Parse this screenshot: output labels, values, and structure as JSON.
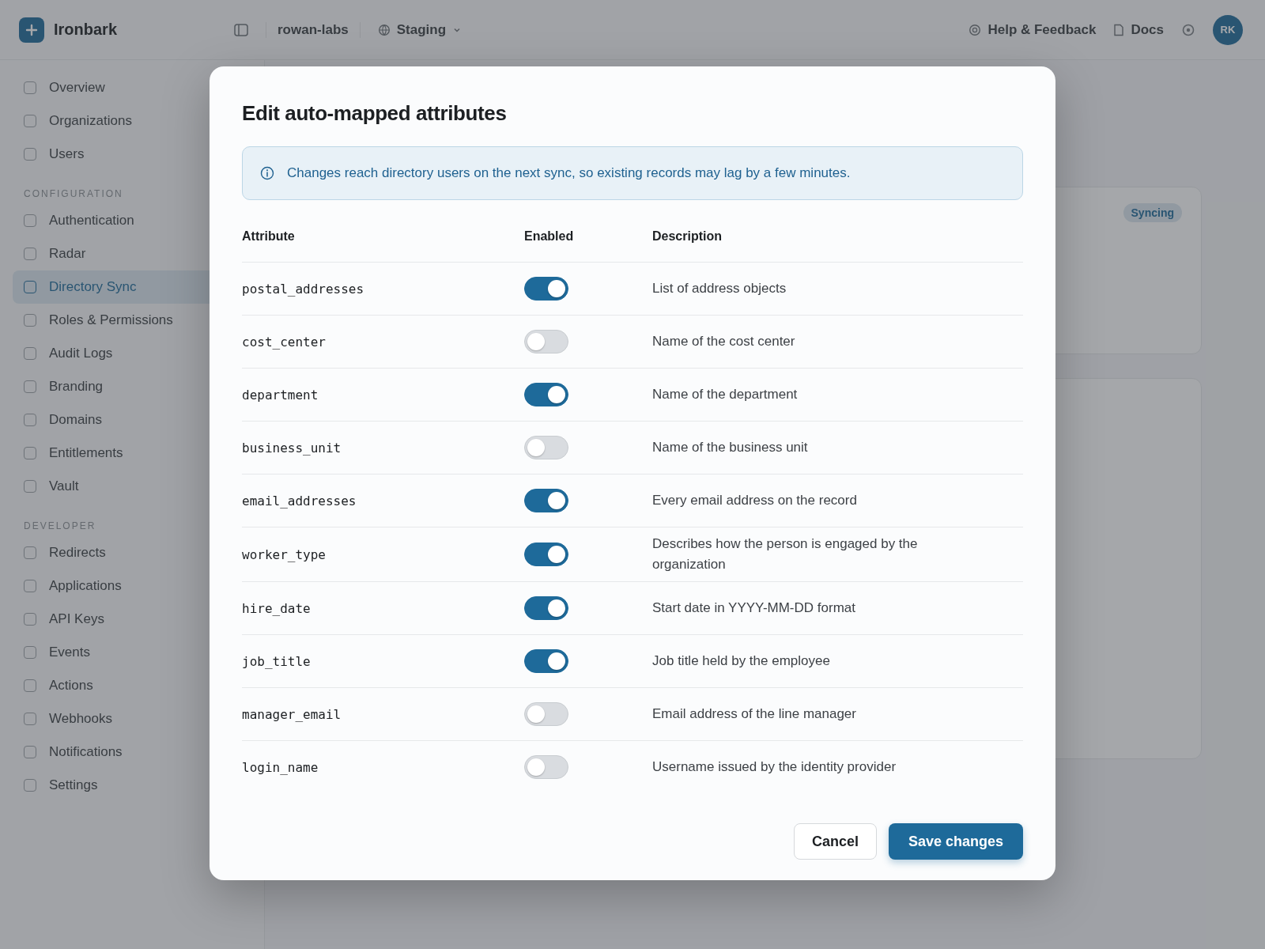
{
  "app": {
    "brand": "Ironbark",
    "org": "rowan-labs",
    "environment": "Staging",
    "help": "Help & Feedback",
    "docs": "Docs",
    "avatar": "RK"
  },
  "sidebar": {
    "sections": [
      {
        "items": [
          {
            "label": "Overview",
            "selected": false
          },
          {
            "label": "Organizations",
            "selected": false
          },
          {
            "label": "Users",
            "selected": false
          }
        ]
      },
      {
        "heading": "CONFIGURATION",
        "items": [
          {
            "label": "Authentication",
            "selected": false
          },
          {
            "label": "Radar",
            "selected": false
          },
          {
            "label": "Directory Sync",
            "selected": true
          },
          {
            "label": "Roles & Permissions",
            "selected": false
          },
          {
            "label": "Audit Logs",
            "selected": false
          },
          {
            "label": "Branding",
            "selected": false
          },
          {
            "label": "Domains",
            "selected": false
          },
          {
            "label": "Entitlements",
            "selected": false
          },
          {
            "label": "Vault",
            "selected": false
          }
        ]
      },
      {
        "heading": "DEVELOPER",
        "items": [
          {
            "label": "Redirects",
            "selected": false
          },
          {
            "label": "Applications",
            "selected": false
          },
          {
            "label": "API Keys",
            "selected": false
          },
          {
            "label": "Events",
            "selected": false
          },
          {
            "label": "Actions",
            "selected": false
          },
          {
            "label": "Webhooks",
            "selected": false
          },
          {
            "label": "Notifications",
            "selected": false
          },
          {
            "label": "Settings",
            "selected": false
          }
        ]
      }
    ]
  },
  "main": {
    "status_badge": "Syncing"
  },
  "dialog": {
    "title": "Edit auto-mapped attributes",
    "notice": "Changes reach directory users on the next sync, so existing records may lag by a few minutes.",
    "columns": [
      "Attribute",
      "Enabled",
      "Description"
    ],
    "rows": [
      {
        "attribute": "postal_addresses",
        "enabled": true,
        "description": "List of address objects"
      },
      {
        "attribute": "cost_center",
        "enabled": false,
        "description": "Name of the cost center"
      },
      {
        "attribute": "department",
        "enabled": true,
        "description": "Name of the department"
      },
      {
        "attribute": "business_unit",
        "enabled": false,
        "description": "Name of the business unit"
      },
      {
        "attribute": "email_addresses",
        "enabled": true,
        "description": "Every email address on the record"
      },
      {
        "attribute": "worker_type",
        "enabled": true,
        "description": "Describes how the person is engaged by the organization"
      },
      {
        "attribute": "hire_date",
        "enabled": true,
        "description": "Start date in YYYY-MM-DD format"
      },
      {
        "attribute": "job_title",
        "enabled": true,
        "description": "Job title held by the employee"
      },
      {
        "attribute": "manager_email",
        "enabled": false,
        "description": "Email address of the line manager"
      },
      {
        "attribute": "login_name",
        "enabled": false,
        "description": "Username issued by the identity provider"
      }
    ],
    "buttons": {
      "cancel": "Cancel",
      "save": "Save changes"
    }
  }
}
